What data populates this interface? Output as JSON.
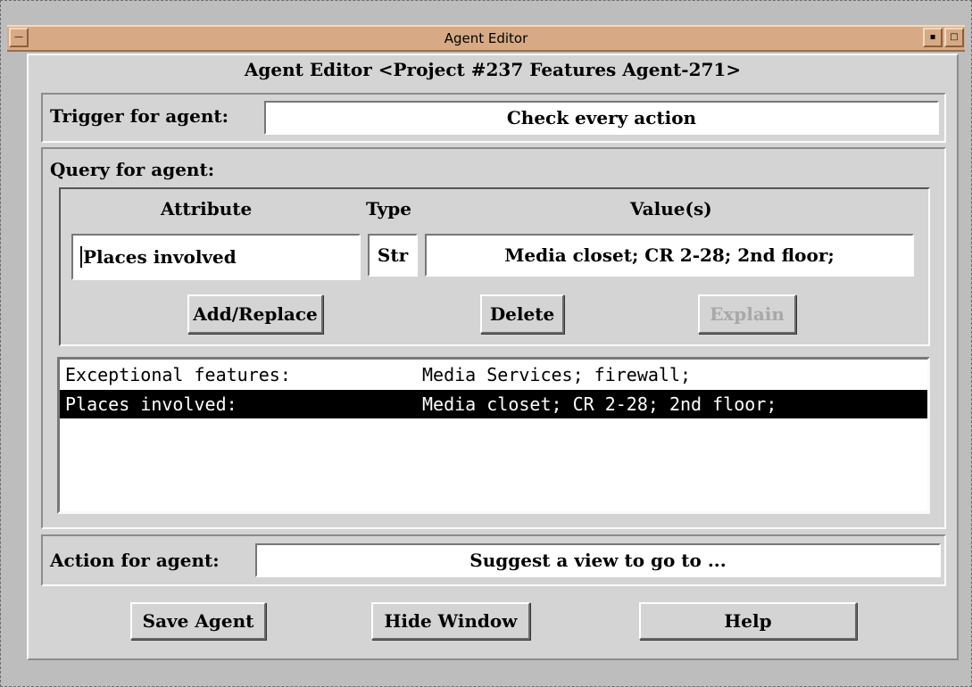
{
  "window": {
    "title": "Agent Editor",
    "heading": "Agent Editor <Project #237 Features Agent-271>"
  },
  "trigger": {
    "label": "Trigger for agent:",
    "value": "Check every action"
  },
  "query": {
    "label": "Query for agent:",
    "headers": {
      "attribute": "Attribute",
      "type": "Type",
      "values": "Value(s)"
    },
    "attribute_value": "Places involved",
    "type_value": "Str",
    "values_value": "Media closet; CR 2-28; 2nd floor;",
    "buttons": {
      "add_replace": "Add/Replace",
      "delete": "Delete",
      "explain": "Explain"
    },
    "list": [
      {
        "attribute": "Exceptional features:",
        "values": "Media Services; firewall;",
        "selected": false
      },
      {
        "attribute": "Places involved:",
        "values": "Media closet; CR 2-28; 2nd floor;",
        "selected": true
      }
    ]
  },
  "action": {
    "label": "Action for agent:",
    "value": "Suggest a view to go to ..."
  },
  "footer": {
    "save": "Save Agent",
    "hide": "Hide Window",
    "help": "Help"
  },
  "icons": {
    "window_menu": "window-menu-icon",
    "minimize": "minimize-icon",
    "maximize": "maximize-icon"
  },
  "colors": {
    "titlebar": "#d7aa85",
    "selection": "#000000",
    "window_bg": "#d4d4d4"
  }
}
